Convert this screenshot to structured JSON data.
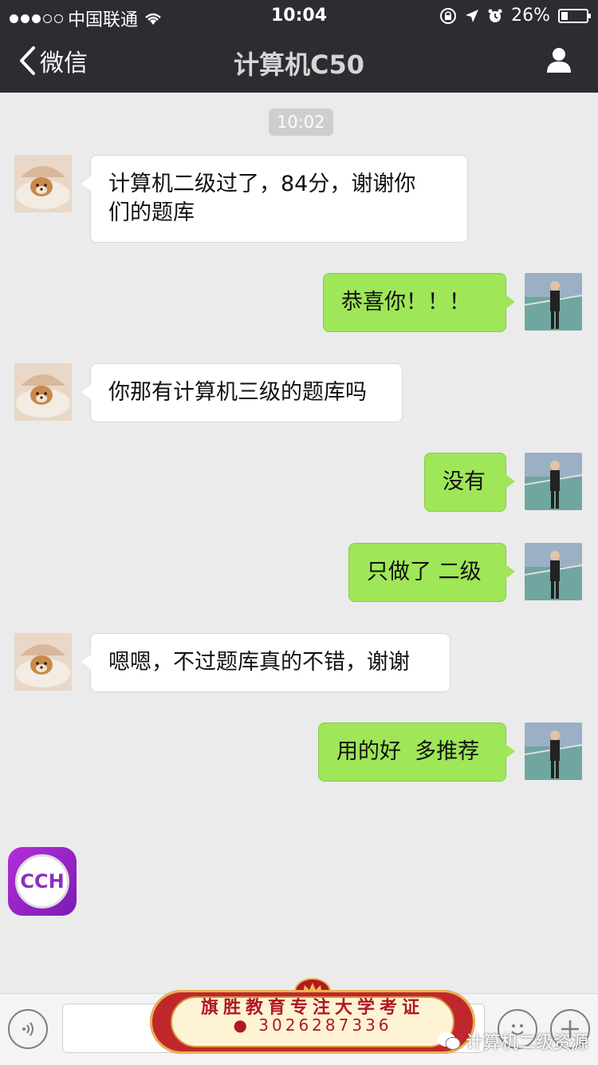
{
  "status_bar": {
    "carrier": "中国联通",
    "time": "10:04",
    "battery": "26%",
    "battery_level": 0.26,
    "icons": [
      "signal-dots-icon",
      "wifi-icon",
      "rotation-lock-icon",
      "location-arrow-icon",
      "alarm-icon",
      "battery-icon"
    ]
  },
  "nav": {
    "back_label": "微信",
    "title": "计算机C50",
    "profile_icon": "person-icon"
  },
  "chat": {
    "timestamp": "10:02",
    "messages": [
      {
        "side": "in",
        "lines": [
          "计算机二级过了，84分，谢谢你",
          "们的题库"
        ]
      },
      {
        "side": "out",
        "lines": [
          "恭喜你！！！"
        ]
      },
      {
        "side": "in",
        "lines": [
          "你那有计算机三级的题库吗"
        ]
      },
      {
        "side": "out",
        "lines": [
          "没有"
        ]
      },
      {
        "side": "out",
        "lines": [
          "只做了 二级"
        ]
      },
      {
        "side": "in",
        "lines": [
          "嗯嗯，不过题库真的不错，谢谢"
        ]
      },
      {
        "side": "out",
        "lines": [
          "用的好  多推荐"
        ]
      }
    ],
    "sticker_text": "CCH"
  },
  "banner": {
    "line1": "旗胜教育专注大学考证",
    "line2": "3026287336"
  },
  "watermark": "计算机二级资源",
  "colors": {
    "header_bg": "#2c2c31",
    "chat_bg": "#ebebeb",
    "out_bubble": "#9fe658",
    "in_bubble": "#ffffff"
  }
}
